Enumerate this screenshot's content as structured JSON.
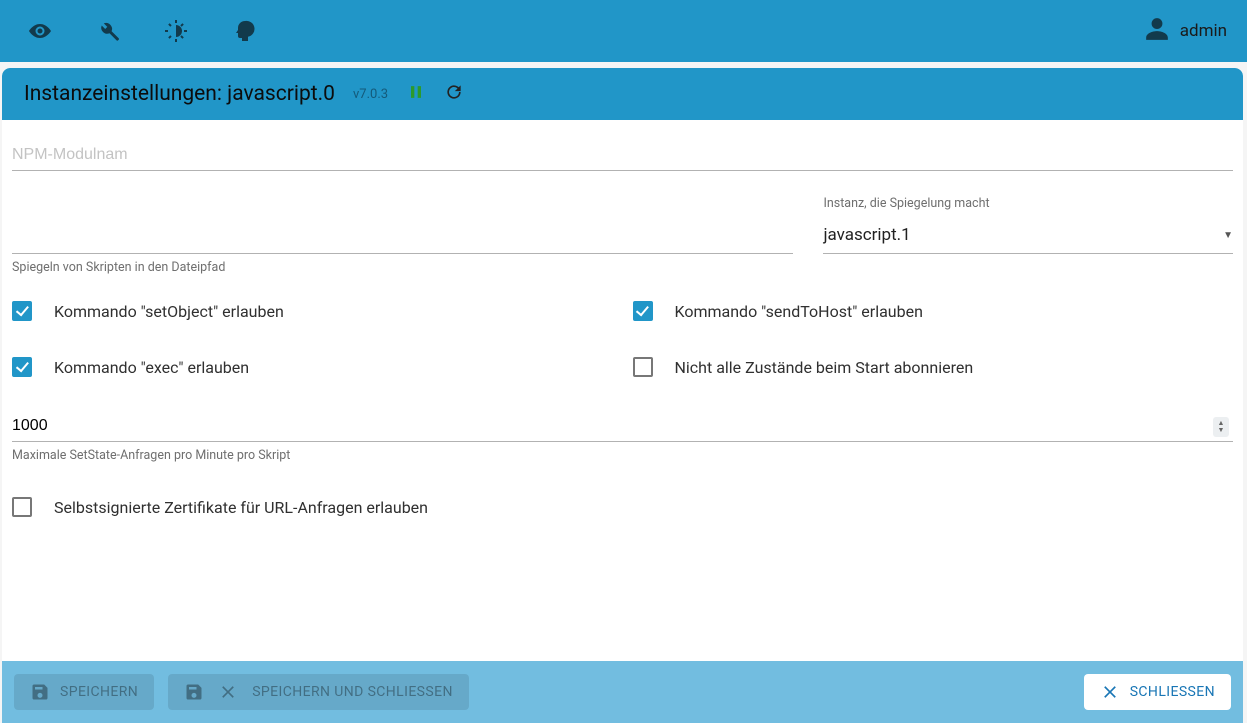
{
  "appbar": {
    "user_label": "admin"
  },
  "panel": {
    "title": "Instanzeinstellungen: javascript.0",
    "version": "v7.0.3"
  },
  "fields": {
    "npm_module_placeholder": "NPM-Modulnam",
    "mirror_path_value": "",
    "mirror_path_helper": "Spiegeln von Skripten in den Dateipfad",
    "mirror_instance_label": "Instanz, die Spiegelung macht",
    "mirror_instance_value": "javascript.1",
    "max_setstate_value": "1000",
    "max_setstate_helper": "Maximale SetState-Anfragen pro Minute pro Skript"
  },
  "checks": {
    "setobject_label": "Kommando \"setObject\" erlauben",
    "setobject_checked": true,
    "sendtohost_label": "Kommando \"sendToHost\" erlauben",
    "sendtohost_checked": true,
    "exec_label": "Kommando \"exec\" erlauben",
    "exec_checked": true,
    "nosub_label": "Nicht alle Zustände beim Start abonnieren",
    "nosub_checked": false,
    "selfsigned_label": "Selbstsignierte Zertifikate für URL-Anfragen erlauben",
    "selfsigned_checked": false
  },
  "footer": {
    "save_label": "Speichern",
    "save_close_label": "Speichern und Schliessen",
    "close_label": "Schliessen"
  }
}
